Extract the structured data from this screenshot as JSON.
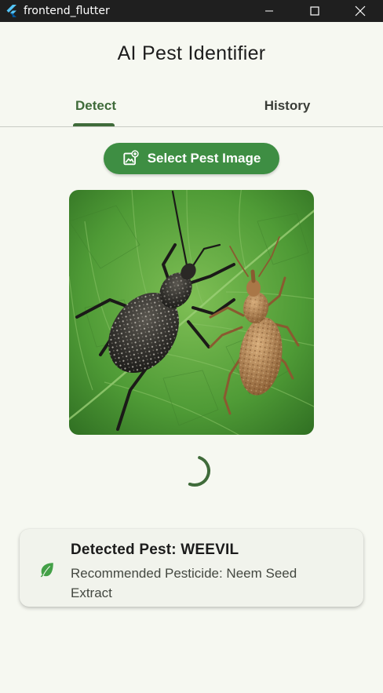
{
  "window": {
    "title": "frontend_flutter",
    "icons": {
      "app": "flutter-logo-icon",
      "minimize": "minimize-icon",
      "maximize": "maximize-icon",
      "close": "close-icon"
    }
  },
  "appbar": {
    "title": "AI Pest Identifier"
  },
  "tabs": [
    {
      "label": "Detect",
      "selected": true
    },
    {
      "label": "History",
      "selected": false
    }
  ],
  "actions": {
    "select_image_label": "Select Pest Image",
    "select_image_icon": "add-photo-icon"
  },
  "image": {
    "subject": "weevil-photo"
  },
  "loading": {
    "indicator": "circular-progress"
  },
  "result": {
    "icon": "leaf-icon",
    "title": "Detected Pest: WEEVIL",
    "recommendation": "Recommended Pesticide: Neem Seed Extract"
  },
  "colors": {
    "primary": "#3e8e43",
    "tab_active": "#3f6b3a",
    "background": "#f6f8f1",
    "card": "#f1f3ec",
    "titlebar": "#1f1f1f"
  }
}
